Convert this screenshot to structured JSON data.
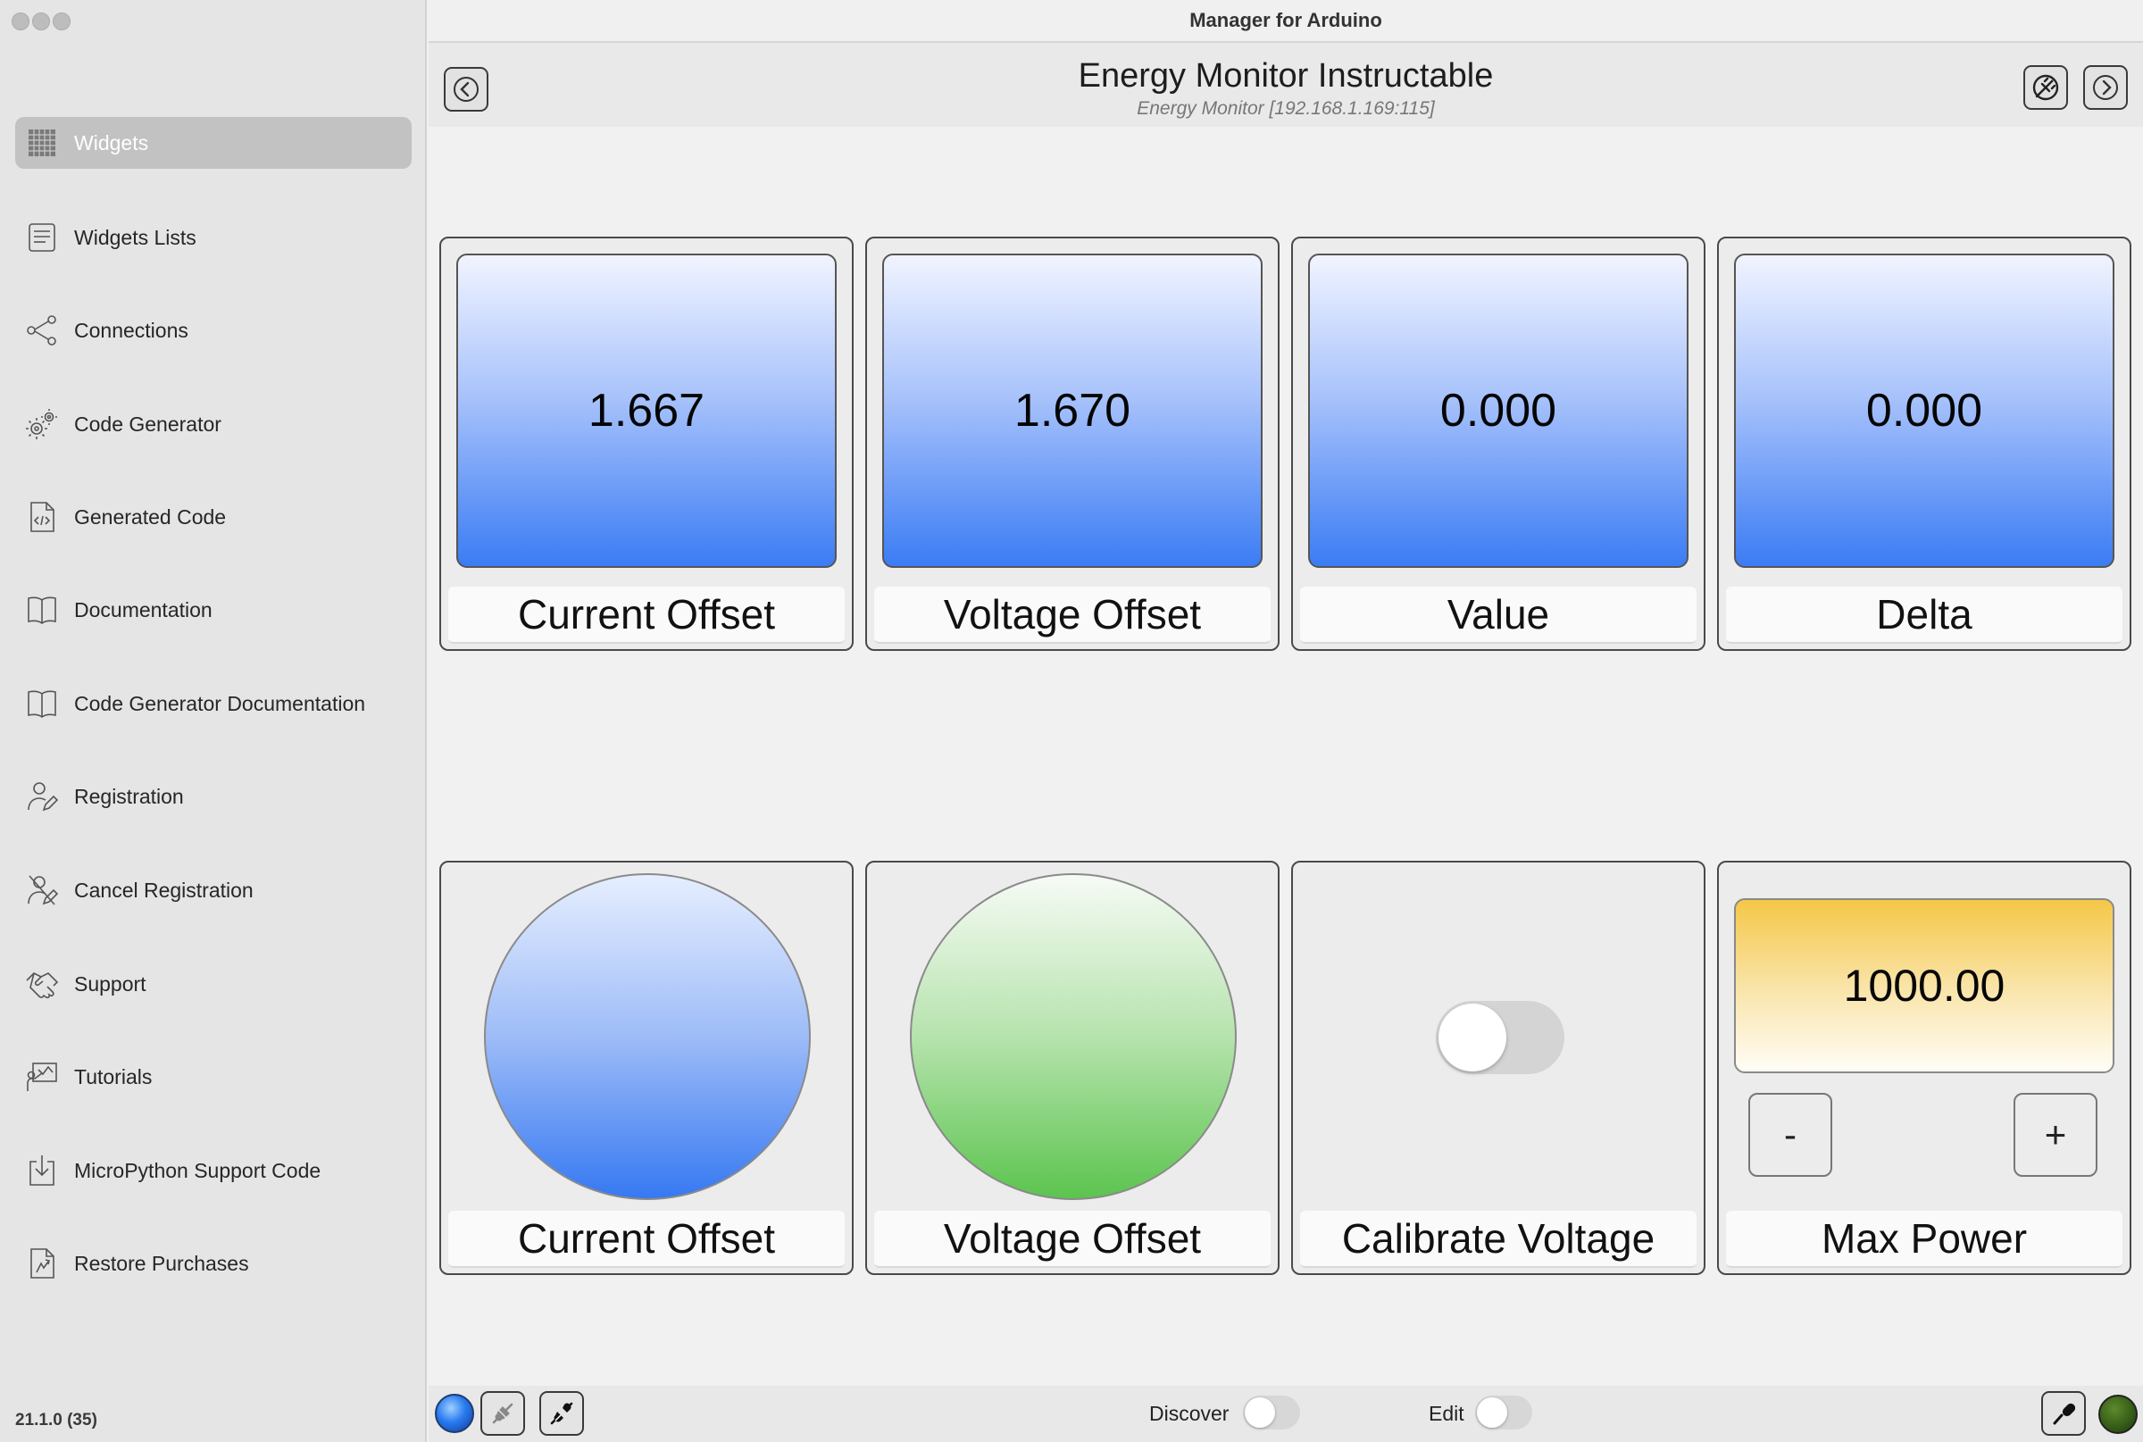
{
  "window": {
    "title": "Manager for Arduino"
  },
  "sidebar": {
    "items": [
      {
        "label": "Widgets",
        "icon": "grid-icon",
        "selected": true
      },
      {
        "label": "Widgets Lists",
        "icon": "list-document-icon"
      },
      {
        "label": "Connections",
        "icon": "share-nodes-icon"
      },
      {
        "label": "Code Generator",
        "icon": "gears-icon"
      },
      {
        "label": "Generated Code",
        "icon": "code-file-icon"
      },
      {
        "label": "Documentation",
        "icon": "book-icon"
      },
      {
        "label": "Code Generator Documentation",
        "icon": "book-icon"
      },
      {
        "label": "Registration",
        "icon": "person-pen-icon"
      },
      {
        "label": "Cancel Registration",
        "icon": "person-cross-icon"
      },
      {
        "label": "Support",
        "icon": "handshake-icon"
      },
      {
        "label": "Tutorials",
        "icon": "presentation-icon"
      },
      {
        "label": "MicroPython Support Code",
        "icon": "download-file-icon"
      },
      {
        "label": "Restore Purchases",
        "icon": "restore-file-icon"
      }
    ],
    "version": "21.1.0 (35)"
  },
  "header": {
    "title": "Energy Monitor Instructable",
    "subtitle": "Energy Monitor   [192.168.1.169:115]"
  },
  "widgets": {
    "row1": [
      {
        "type": "value-display",
        "value": "1.667",
        "label": "Current Offset"
      },
      {
        "type": "value-display",
        "value": "1.670",
        "label": "Voltage Offset"
      },
      {
        "type": "value-display",
        "value": "0.000",
        "label": "Value"
      },
      {
        "type": "value-display",
        "value": "0.000",
        "label": "Delta"
      }
    ],
    "row2": [
      {
        "type": "led",
        "color": "#3679f2",
        "label": "Current Offset"
      },
      {
        "type": "led",
        "color": "#5cc44f",
        "label": "Voltage Offset"
      },
      {
        "type": "switch",
        "on": false,
        "label": "Calibrate Voltage"
      },
      {
        "type": "stepper",
        "value": "1000.00",
        "minus": "-",
        "plus": "+",
        "label": "Max Power"
      }
    ]
  },
  "bottombar": {
    "discover_label": "Discover",
    "discover_on": false,
    "edit_label": "Edit",
    "edit_on": false
  },
  "colors": {
    "accent_blue": "#3b7cf4",
    "led_green": "#5cc44f",
    "stepper_gold": "#f5c748",
    "status_dot": "#3a5e18"
  }
}
